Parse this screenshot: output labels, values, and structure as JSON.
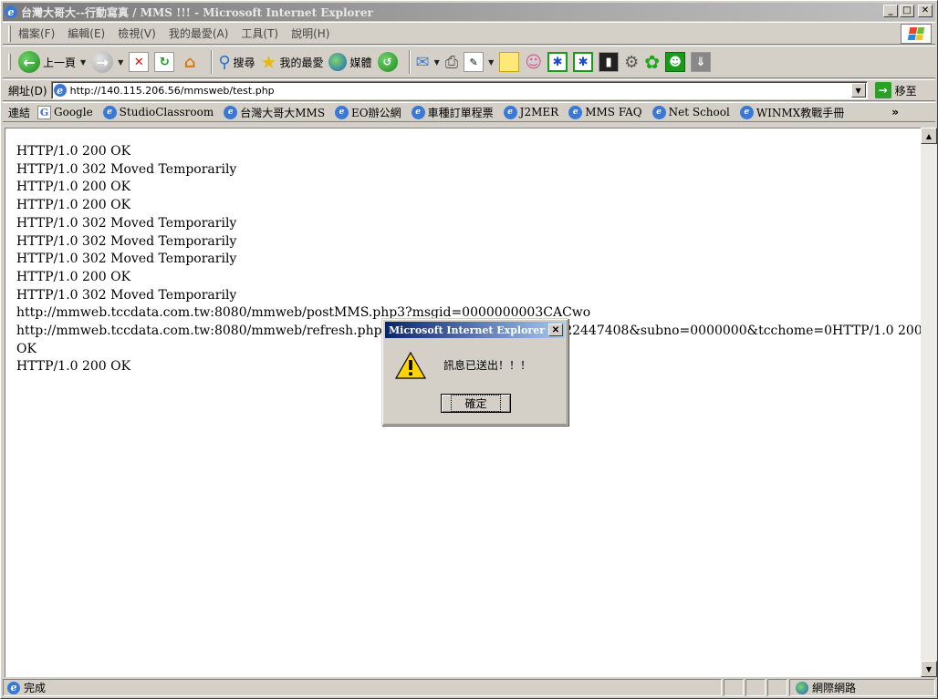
{
  "window": {
    "title": "台灣大哥大--行動寫真 / MMS !!! - Microsoft Internet Explorer"
  },
  "menu": [
    "檔案(F)",
    "編輯(E)",
    "檢視(V)",
    "我的最愛(A)",
    "工具(T)",
    "說明(H)"
  ],
  "toolbar": {
    "back_label": "上一頁",
    "search_label": "搜尋",
    "favorites_label": "我的最愛",
    "media_label": "媒體"
  },
  "address": {
    "label": "網址(D)",
    "url": "http://140.115.206.56/mmsweb/test.php",
    "go_label": "移至"
  },
  "links": {
    "label": "連結",
    "items": [
      "Google",
      "StudioClassroom",
      "台灣大哥大MMS",
      "EO辦公網",
      "車種訂單程票",
      "J2MER",
      "MMS FAQ",
      "Net School",
      "WINMX教戰手冊"
    ]
  },
  "content": {
    "lines": [
      "HTTP/1.0 200 OK",
      "HTTP/1.0 302 Moved Temporarily",
      "HTTP/1.0 200 OK",
      "HTTP/1.0 200 OK",
      "HTTP/1.0 302 Moved Temporarily",
      "HTTP/1.0 302 Moved Temporarily",
      "HTTP/1.0 302 Moved Temporarily",
      "HTTP/1.0 200 OK",
      "HTTP/1.0 302 Moved Temporarily",
      "http://mmweb.tccdata.com.tw:8080/mmweb/postMMS.php3?msgid=0000000003CACwo",
      "http://mmweb.tccdata.com.tw:8080/mmweb/refresh.php3?url=                              0922447408&subno=0000000&tcchome=0HTTP/1.0 200",
      "OK",
      "HTTP/1.0 200 OK"
    ]
  },
  "status": {
    "text": "完成",
    "zone": "網際網路"
  },
  "dialog": {
    "title": "Microsoft Internet Explorer",
    "message": "訊息已送出！！！",
    "ok_label": "確定"
  }
}
